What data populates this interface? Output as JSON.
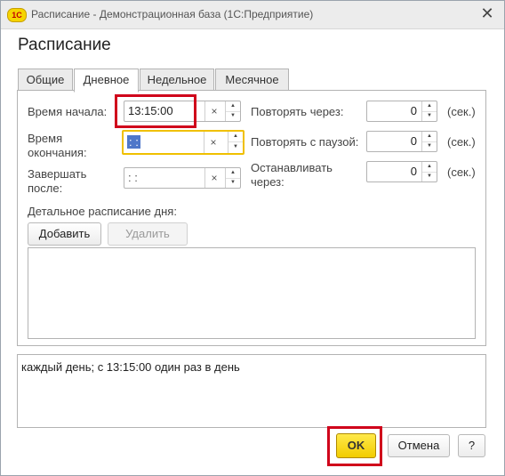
{
  "window": {
    "logo_text": "1C",
    "title": "Расписание - Демонстрационная база  (1С:Предприятие)",
    "close_glyph": "✕"
  },
  "form": {
    "title": "Расписание"
  },
  "tabs": [
    {
      "label": "Общие",
      "active": false
    },
    {
      "label": "Дневное",
      "active": true
    },
    {
      "label": "Недельное",
      "active": false
    },
    {
      "label": "Месячное",
      "active": false
    }
  ],
  "daily": {
    "start_label": "Время начала:",
    "start_value": "13:15:00",
    "end_label_1": "Время",
    "end_label_2": "окончания:",
    "end_value": " :  : ",
    "finish_label_1": "Завершать",
    "finish_label_2": "после:",
    "finish_value": " :  : ",
    "repeat_label": "Повторять через:",
    "repeat_value": "0",
    "pause_label": "Повторять с паузой:",
    "pause_value": "0",
    "stop_label_1": "Останавливать",
    "stop_label_2": "через:",
    "stop_value": "0",
    "unit": "(сек.)",
    "detailed_label": "Детальное расписание дня:",
    "add_label": "Добавить",
    "delete_label": "Удалить",
    "clear_glyph": "×",
    "spin_up": "▲",
    "spin_down": "▼"
  },
  "summary_text": "каждый день; с 13:15:00 один раз в день",
  "footer": {
    "ok_label": "OK",
    "cancel_label": "Отмена",
    "help_label": "?"
  },
  "colors": {
    "highlight": "#d0021b",
    "ok_button": "#f2cc00",
    "focus_border": "#f0c000"
  }
}
